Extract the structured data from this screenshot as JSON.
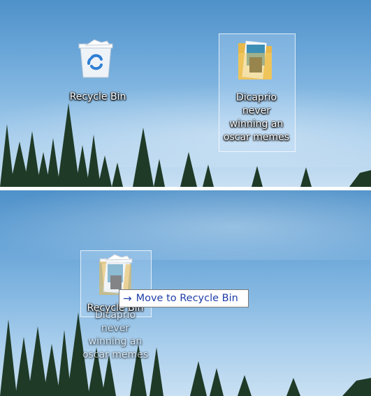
{
  "top_desktop": {
    "recycle_bin": {
      "label": "Recycle Bin",
      "icon": "recycle-bin-icon"
    },
    "folder": {
      "label_lines": [
        "Dicaprio",
        "never",
        "winning an",
        "oscar memes"
      ],
      "icon": "folder-icon"
    }
  },
  "bottom_desktop": {
    "recycle_bin": {
      "label": "Recycle Bin",
      "icon": "recycle-bin-icon"
    },
    "dragged_folder": {
      "label_lines": [
        "Dicaprio",
        "never",
        "winning an",
        "oscar memes"
      ],
      "icon": "folder-icon"
    },
    "drag_tooltip": {
      "arrow": "→",
      "text": "Move to Recycle Bin"
    }
  },
  "colors": {
    "sky_top": "#4f91c9",
    "sky_bottom": "#c9e0f2",
    "tooltip_text": "#1e3ea8",
    "trees": "#1f3a27"
  }
}
